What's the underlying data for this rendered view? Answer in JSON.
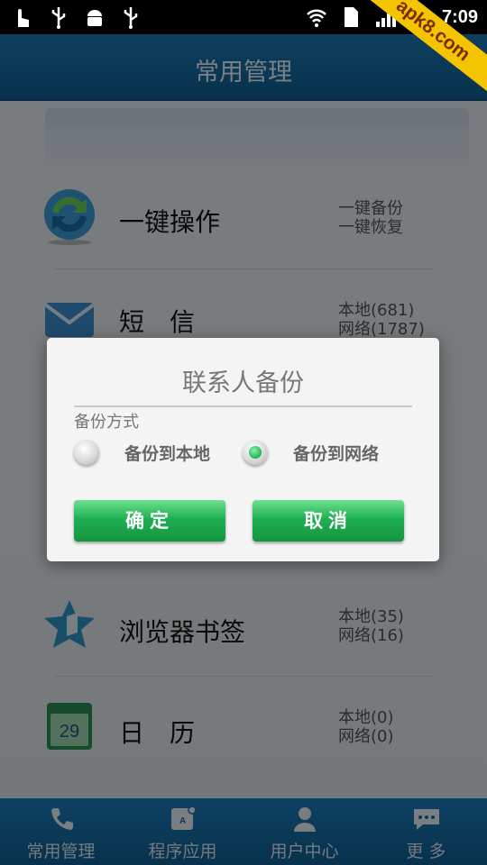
{
  "status_bar": {
    "time": "7:09",
    "left_icons": [
      "touch-icon",
      "usb-icon",
      "android-icon",
      "usb-icon"
    ],
    "right_icons": [
      "wifi-icon",
      "sim-icon",
      "signal-icon",
      "battery-icon"
    ],
    "watermark": "apk8.com"
  },
  "header": {
    "title": "常用管理"
  },
  "list": [
    {
      "title": "一键操作",
      "line1": "一键备份",
      "line2": "一键恢复",
      "icon": "sync-icon"
    },
    {
      "title": "短　信",
      "line1": "本地(681)",
      "line2": "网络(1787)",
      "icon": "message-icon"
    },
    {
      "title": "浏览器书签",
      "line1": "本地(35)",
      "line2": "网络(16)",
      "icon": "bookmark-icon"
    },
    {
      "title": "日　历",
      "line1": "本地(0)",
      "line2": "网络(0)",
      "icon": "calendar-icon",
      "calendar_day": "29"
    }
  ],
  "dialog": {
    "title": "联系人备份",
    "section_label": "备份方式",
    "options": [
      {
        "label": "备份到本地",
        "selected": false
      },
      {
        "label": "备份到网络",
        "selected": true
      }
    ],
    "confirm_label": "确定",
    "cancel_label": "取消"
  },
  "bottom_nav": [
    {
      "label": "常用管理",
      "icon": "phone-icon"
    },
    {
      "label": "程序应用",
      "icon": "app-icon"
    },
    {
      "label": "用户中心",
      "icon": "user-icon"
    },
    {
      "label": "更 多",
      "icon": "chat-icon"
    }
  ]
}
